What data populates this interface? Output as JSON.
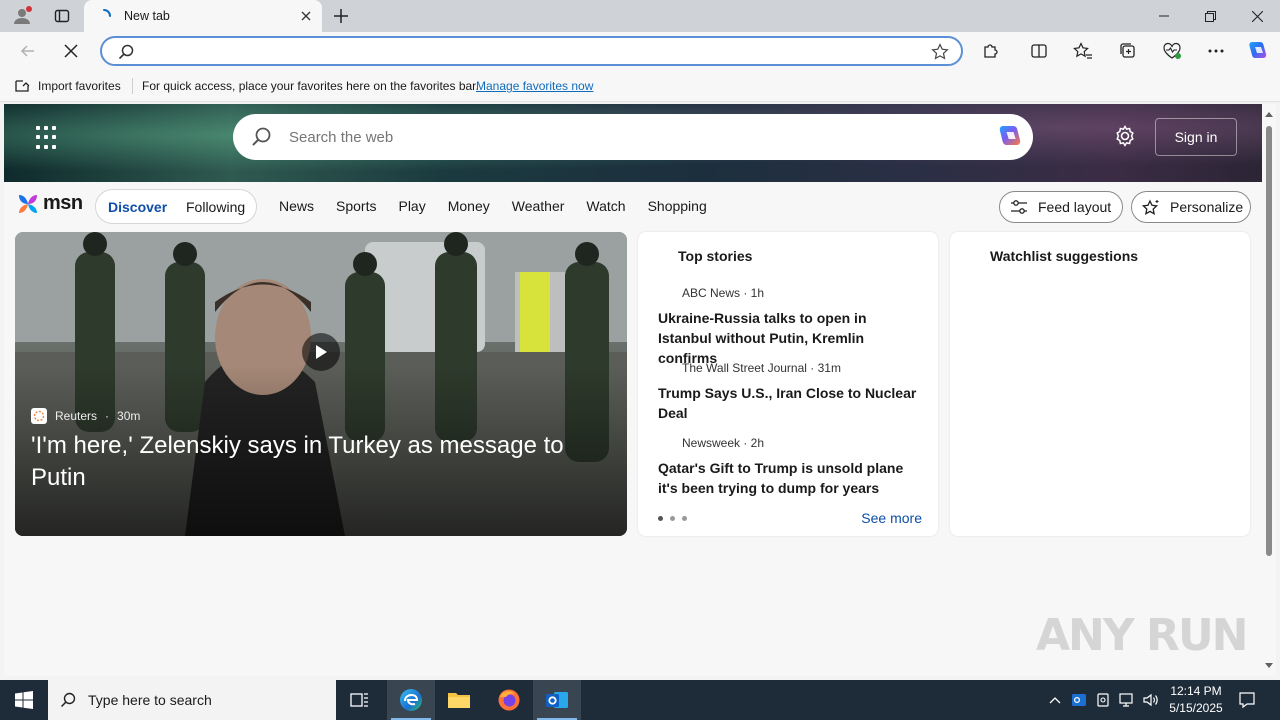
{
  "browser": {
    "tab_title": "New tab",
    "address_value": "",
    "address_placeholder": ""
  },
  "favorites_bar": {
    "import_label": "Import favorites",
    "message": "For quick access, place your favorites here on the favorites bar.",
    "manage_link": "Manage favorites now"
  },
  "msn": {
    "search_placeholder": "Search the web",
    "sign_in": "Sign in",
    "logo": "msn",
    "tabs": [
      "Discover",
      "Following"
    ],
    "nav": [
      "News",
      "Sports",
      "Play",
      "Money",
      "Weather",
      "Watch",
      "Shopping"
    ],
    "feed_layout": "Feed layout",
    "personalize": "Personalize",
    "hero": {
      "source": "Reuters",
      "time": "30m",
      "title": "'I'm here,' Zelenskiy says in Turkey as message to Putin"
    },
    "top_stories": {
      "heading": "Top stories",
      "items": [
        {
          "source": "ABC News · 1h",
          "headline": "Ukraine-Russia talks to open in Istanbul without Putin, Kremlin confirms"
        },
        {
          "source": "The Wall Street Journal · 31m",
          "headline": "Trump Says U.S., Iran Close to Nuclear Deal"
        },
        {
          "source": "Newsweek · 2h",
          "headline": "Qatar's Gift to Trump is unsold plane it's been trying to dump for years"
        }
      ],
      "see_more": "See more"
    },
    "watchlist": {
      "heading": "Watchlist suggestions"
    },
    "watermark": "ANY RUN"
  },
  "taskbar": {
    "search_placeholder": "Type here to search",
    "time": "12:14 PM",
    "date": "5/15/2025"
  },
  "colors": {
    "accent": "#0f4fa8",
    "link": "#0f6cbd",
    "taskbar": "#1e2c3a"
  }
}
